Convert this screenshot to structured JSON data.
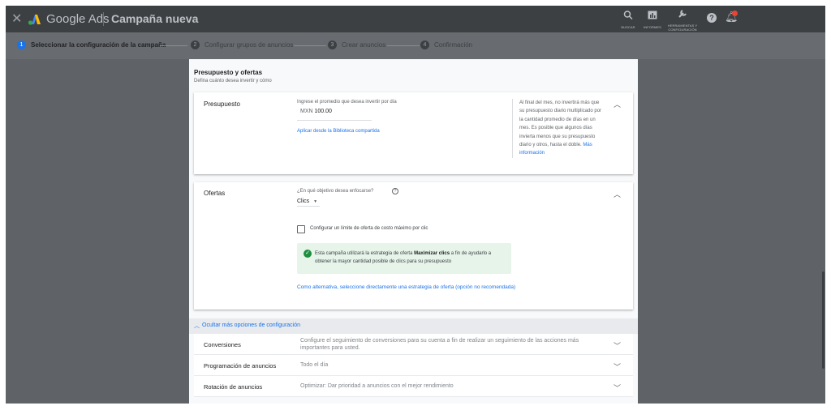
{
  "topbar": {
    "brand": "Google Ads",
    "title": "Campaña nueva",
    "tools": [
      {
        "icon": "search-icon",
        "label": "BUSCAR"
      },
      {
        "icon": "reports-icon",
        "label": "INFORMES"
      },
      {
        "icon": "wrench-icon",
        "label": "HERRAMIENTAS Y CONFIGURACIÓN"
      }
    ],
    "help_icon": "?",
    "notification_count": "1"
  },
  "stepper": {
    "steps": [
      {
        "num": "1",
        "label": "Seleccionar la configuración de la campaña"
      },
      {
        "num": "2",
        "label": "Configurar grupos de anuncios"
      },
      {
        "num": "3",
        "label": "Crear anuncios"
      },
      {
        "num": "4",
        "label": "Confirmación"
      }
    ]
  },
  "section": {
    "title": "Presupuesto y ofertas",
    "subtitle": "Defina cuánto desea invertir y cómo"
  },
  "budget": {
    "label": "Presupuesto",
    "hint": "Ingrese el promedio que desea invertir por día",
    "currency": "MXN",
    "amount": "100.00",
    "library_link": "Aplicar desde la Biblioteca compartida",
    "note": "Al final del mes, no invertirá más que su presupuesto diario multiplicado por la cantidad promedio de días en un mes. Es posible que algunos días invierta menos que su presupuesto diario y otros, hasta el doble.",
    "note_link": "Más información"
  },
  "bids": {
    "label": "Ofertas",
    "question": "¿En qué objetivo desea enfocarse?",
    "selected": "Clics",
    "checkbox_label": "Configurar un límite de oferta de costo máximo por clic",
    "info_pre": "Esta campaña utilizará la estrategia de oferta ",
    "info_bold": "Maximizar clics",
    "info_post": " a fin de ayudarlo a obtener la mayor cantidad posible de clics para su presupuesto",
    "alt_link": "Como alternativa, seleccione directamente una estrategia de oferta (opción no recomendada)"
  },
  "more_options": {
    "label": "Ocultar más opciones de configuración"
  },
  "rows": [
    {
      "label": "Conversiones",
      "value": "Configure el seguimiento de conversiones para su cuenta a fin de realizar un seguimiento de las acciones más importantes para usted."
    },
    {
      "label": "Programación de anuncios",
      "value": "Todo el día"
    },
    {
      "label": "Rotación de anuncios",
      "value": "Optimizar: Dar prioridad a anuncios con el mejor rendimiento"
    }
  ],
  "colors": {
    "accent": "#1a73e8",
    "success": "#1e8e3e",
    "overlay": "#5f6368"
  }
}
